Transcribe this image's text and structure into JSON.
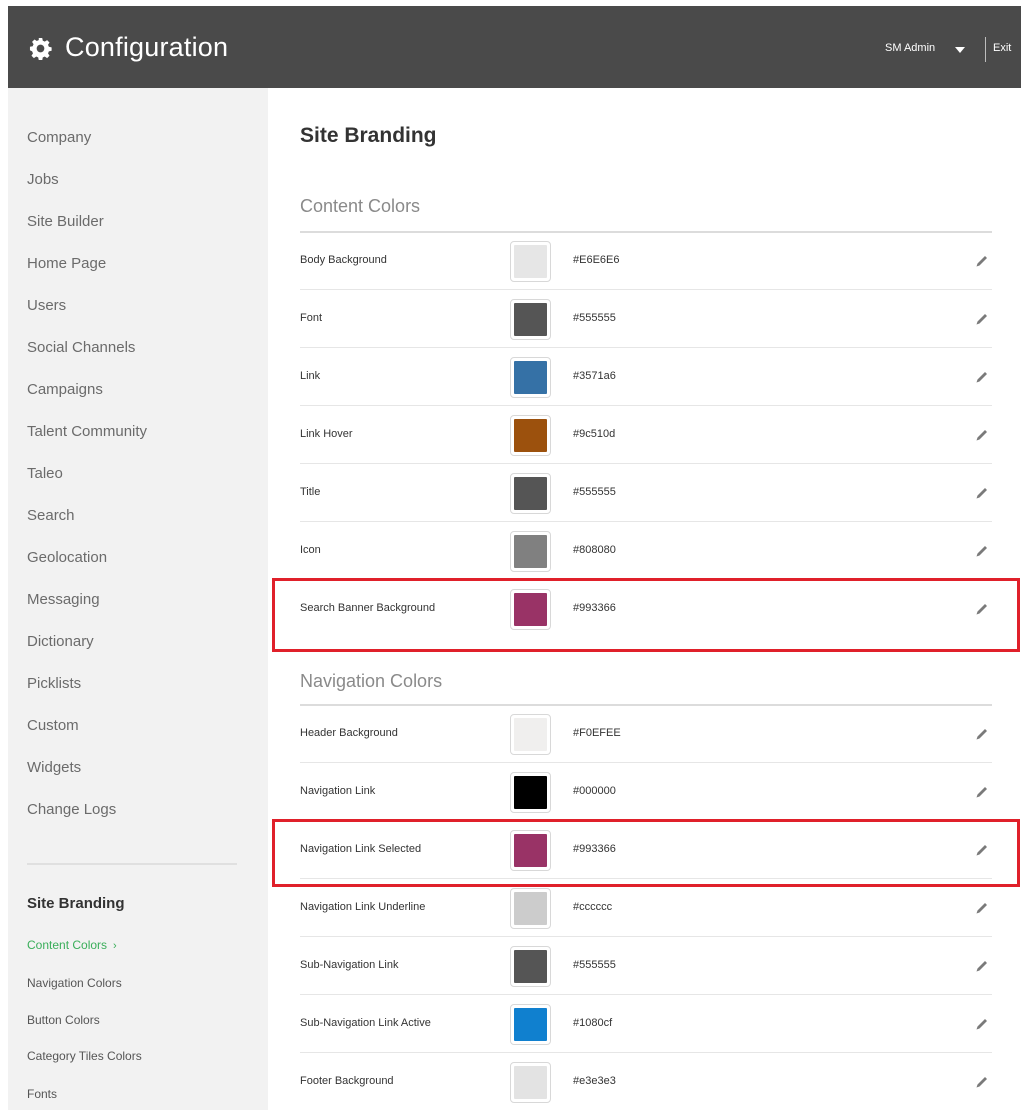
{
  "header": {
    "title": "Configuration",
    "user_label": "SM Admin",
    "exit_label": "Exit"
  },
  "sidebar": {
    "items": [
      {
        "label": "Company"
      },
      {
        "label": "Jobs"
      },
      {
        "label": "Site Builder"
      },
      {
        "label": "Home Page"
      },
      {
        "label": "Users"
      },
      {
        "label": "Social Channels"
      },
      {
        "label": "Campaigns"
      },
      {
        "label": "Talent Community"
      },
      {
        "label": "Taleo"
      },
      {
        "label": "Search"
      },
      {
        "label": "Geolocation"
      },
      {
        "label": "Messaging"
      },
      {
        "label": "Dictionary"
      },
      {
        "label": "Picklists"
      },
      {
        "label": "Custom"
      },
      {
        "label": "Widgets"
      },
      {
        "label": "Change Logs"
      }
    ],
    "section_heading": "Site Branding",
    "sub_items": [
      {
        "label": "Content Colors",
        "active": true
      },
      {
        "label": "Navigation Colors"
      },
      {
        "label": "Button Colors"
      },
      {
        "label": "Category Tiles Colors"
      },
      {
        "label": "Fonts"
      }
    ]
  },
  "main": {
    "page_title": "Site Branding",
    "sections": [
      {
        "title": "Content Colors",
        "rows": [
          {
            "label": "Body Background",
            "hex": "#E6E6E6",
            "color": "#E6E6E6"
          },
          {
            "label": "Font",
            "hex": "#555555",
            "color": "#555555"
          },
          {
            "label": "Link",
            "hex": "#3571a6",
            "color": "#3571a6"
          },
          {
            "label": "Link Hover",
            "hex": "#9c510d",
            "color": "#9c510d"
          },
          {
            "label": "Title",
            "hex": "#555555",
            "color": "#555555"
          },
          {
            "label": "Icon",
            "hex": "#808080",
            "color": "#808080"
          },
          {
            "label": "Search Banner Background",
            "hex": "#993366",
            "color": "#993366",
            "highlighted": true
          }
        ]
      },
      {
        "title": "Navigation Colors",
        "rows": [
          {
            "label": "Header Background",
            "hex": "#F0EFEE",
            "color": "#F0EFEE"
          },
          {
            "label": "Navigation Link",
            "hex": "#000000",
            "color": "#000000"
          },
          {
            "label": "Navigation Link Selected",
            "hex": "#993366",
            "color": "#993366",
            "highlighted": true
          },
          {
            "label": "Navigation Link Underline",
            "hex": "#cccccc",
            "color": "#cccccc"
          },
          {
            "label": "Sub-Navigation Link",
            "hex": "#555555",
            "color": "#555555"
          },
          {
            "label": "Sub-Navigation Link Active",
            "hex": "#1080cf",
            "color": "#1080cf"
          },
          {
            "label": "Footer Background",
            "hex": "#e3e3e3",
            "color": "#e3e3e3"
          }
        ]
      }
    ]
  },
  "icons": {
    "header": "gear-icon",
    "user_menu": "caret-down-icon",
    "row_edit": "pencil-icon",
    "active_sub_item": "chevron-right-icon"
  },
  "colors": {
    "topbar": "#4a4a4a",
    "sidebar": "#f2f2f2",
    "active_link": "#3aae5a",
    "highlight_border": "#e0202a"
  }
}
